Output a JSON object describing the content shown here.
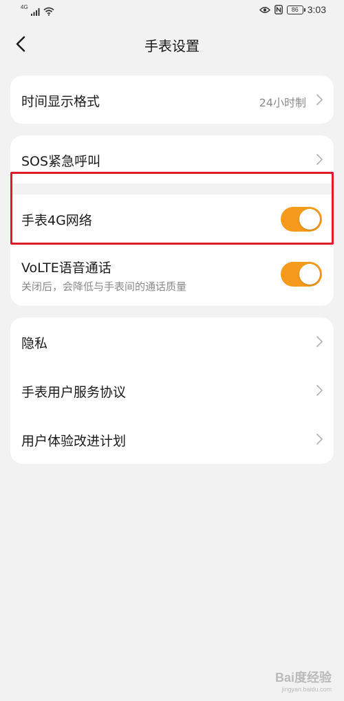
{
  "status_bar": {
    "network_type": "4G",
    "time": "3:03",
    "battery": "86",
    "icons": [
      "signal-icon",
      "wifi-icon",
      "eye-icon",
      "nfc-icon",
      "battery-icon"
    ]
  },
  "header": {
    "title": "手表设置",
    "back_icon": "chevron-left-icon"
  },
  "section1": {
    "time_format": {
      "label": "时间显示格式",
      "value": "24小时制"
    }
  },
  "section2": {
    "sos": {
      "label": "SOS紧急呼叫"
    },
    "network_4g": {
      "label": "手表4G网络",
      "enabled": true
    },
    "volte": {
      "label": "VoLTE语音通话",
      "sublabel": "关闭后，会降低与手表间的通话质量",
      "enabled": true
    }
  },
  "section3": {
    "privacy": {
      "label": "隐私"
    },
    "user_agreement": {
      "label": "手表用户服务协议"
    },
    "ux_program": {
      "label": "用户体验改进计划"
    }
  },
  "colors": {
    "toggle_on": "#f59a1c",
    "highlight": "#e0192b",
    "background": "#f2f2f2"
  },
  "watermark": {
    "main": "Bai度经验",
    "sub": "jingyan.baidu.com"
  }
}
